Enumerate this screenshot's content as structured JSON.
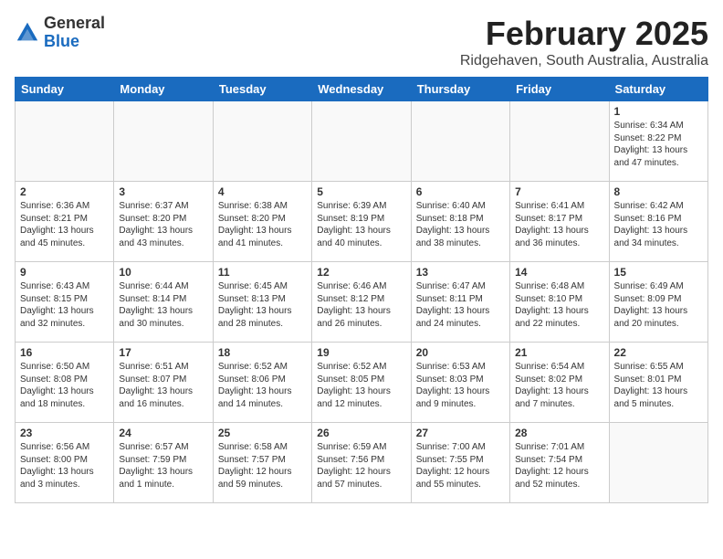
{
  "header": {
    "logo_general": "General",
    "logo_blue": "Blue",
    "month_title": "February 2025",
    "location": "Ridgehaven, South Australia, Australia"
  },
  "weekdays": [
    "Sunday",
    "Monday",
    "Tuesday",
    "Wednesday",
    "Thursday",
    "Friday",
    "Saturday"
  ],
  "weeks": [
    [
      {
        "day": "",
        "info": ""
      },
      {
        "day": "",
        "info": ""
      },
      {
        "day": "",
        "info": ""
      },
      {
        "day": "",
        "info": ""
      },
      {
        "day": "",
        "info": ""
      },
      {
        "day": "",
        "info": ""
      },
      {
        "day": "1",
        "info": "Sunrise: 6:34 AM\nSunset: 8:22 PM\nDaylight: 13 hours and 47 minutes."
      }
    ],
    [
      {
        "day": "2",
        "info": "Sunrise: 6:36 AM\nSunset: 8:21 PM\nDaylight: 13 hours and 45 minutes."
      },
      {
        "day": "3",
        "info": "Sunrise: 6:37 AM\nSunset: 8:20 PM\nDaylight: 13 hours and 43 minutes."
      },
      {
        "day": "4",
        "info": "Sunrise: 6:38 AM\nSunset: 8:20 PM\nDaylight: 13 hours and 41 minutes."
      },
      {
        "day": "5",
        "info": "Sunrise: 6:39 AM\nSunset: 8:19 PM\nDaylight: 13 hours and 40 minutes."
      },
      {
        "day": "6",
        "info": "Sunrise: 6:40 AM\nSunset: 8:18 PM\nDaylight: 13 hours and 38 minutes."
      },
      {
        "day": "7",
        "info": "Sunrise: 6:41 AM\nSunset: 8:17 PM\nDaylight: 13 hours and 36 minutes."
      },
      {
        "day": "8",
        "info": "Sunrise: 6:42 AM\nSunset: 8:16 PM\nDaylight: 13 hours and 34 minutes."
      }
    ],
    [
      {
        "day": "9",
        "info": "Sunrise: 6:43 AM\nSunset: 8:15 PM\nDaylight: 13 hours and 32 minutes."
      },
      {
        "day": "10",
        "info": "Sunrise: 6:44 AM\nSunset: 8:14 PM\nDaylight: 13 hours and 30 minutes."
      },
      {
        "day": "11",
        "info": "Sunrise: 6:45 AM\nSunset: 8:13 PM\nDaylight: 13 hours and 28 minutes."
      },
      {
        "day": "12",
        "info": "Sunrise: 6:46 AM\nSunset: 8:12 PM\nDaylight: 13 hours and 26 minutes."
      },
      {
        "day": "13",
        "info": "Sunrise: 6:47 AM\nSunset: 8:11 PM\nDaylight: 13 hours and 24 minutes."
      },
      {
        "day": "14",
        "info": "Sunrise: 6:48 AM\nSunset: 8:10 PM\nDaylight: 13 hours and 22 minutes."
      },
      {
        "day": "15",
        "info": "Sunrise: 6:49 AM\nSunset: 8:09 PM\nDaylight: 13 hours and 20 minutes."
      }
    ],
    [
      {
        "day": "16",
        "info": "Sunrise: 6:50 AM\nSunset: 8:08 PM\nDaylight: 13 hours and 18 minutes."
      },
      {
        "day": "17",
        "info": "Sunrise: 6:51 AM\nSunset: 8:07 PM\nDaylight: 13 hours and 16 minutes."
      },
      {
        "day": "18",
        "info": "Sunrise: 6:52 AM\nSunset: 8:06 PM\nDaylight: 13 hours and 14 minutes."
      },
      {
        "day": "19",
        "info": "Sunrise: 6:52 AM\nSunset: 8:05 PM\nDaylight: 13 hours and 12 minutes."
      },
      {
        "day": "20",
        "info": "Sunrise: 6:53 AM\nSunset: 8:03 PM\nDaylight: 13 hours and 9 minutes."
      },
      {
        "day": "21",
        "info": "Sunrise: 6:54 AM\nSunset: 8:02 PM\nDaylight: 13 hours and 7 minutes."
      },
      {
        "day": "22",
        "info": "Sunrise: 6:55 AM\nSunset: 8:01 PM\nDaylight: 13 hours and 5 minutes."
      }
    ],
    [
      {
        "day": "23",
        "info": "Sunrise: 6:56 AM\nSunset: 8:00 PM\nDaylight: 13 hours and 3 minutes."
      },
      {
        "day": "24",
        "info": "Sunrise: 6:57 AM\nSunset: 7:59 PM\nDaylight: 13 hours and 1 minute."
      },
      {
        "day": "25",
        "info": "Sunrise: 6:58 AM\nSunset: 7:57 PM\nDaylight: 12 hours and 59 minutes."
      },
      {
        "day": "26",
        "info": "Sunrise: 6:59 AM\nSunset: 7:56 PM\nDaylight: 12 hours and 57 minutes."
      },
      {
        "day": "27",
        "info": "Sunrise: 7:00 AM\nSunset: 7:55 PM\nDaylight: 12 hours and 55 minutes."
      },
      {
        "day": "28",
        "info": "Sunrise: 7:01 AM\nSunset: 7:54 PM\nDaylight: 12 hours and 52 minutes."
      },
      {
        "day": "",
        "info": ""
      }
    ]
  ]
}
